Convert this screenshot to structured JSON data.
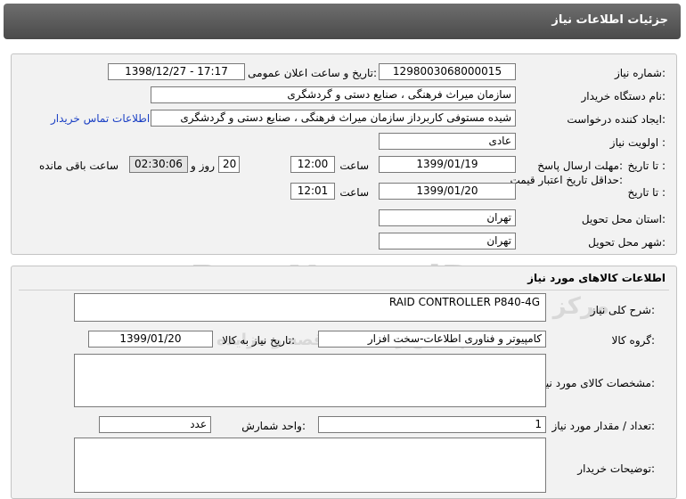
{
  "header": {
    "title": "جزئیات اطلاعات نیاز"
  },
  "need": {
    "need_number_label": "شماره نیاز:",
    "need_number": "1298003068000015",
    "announce_label": "تاریخ و ساعت اعلان عمومی:",
    "announce_value": "1398/12/27 - 17:17",
    "buyer_org_label": "نام دستگاه خریدار:",
    "buyer_org": "سازمان میراث فرهنگی ، صنایع دستی و گردشگری",
    "creator_label": "ایجاد کننده درخواست:",
    "creator": "شیده مستوفی کاربرداز سازمان میراث فرهنگی ، صنایع دستی و گردشگری",
    "contact_link": "اطلاعات تماس خریدار",
    "priority_label": "اولویت نیاز :",
    "priority": "عادی",
    "deadline_label": "مهلت ارسال پاسخ:",
    "to_date_label": "تا تاریخ :",
    "deadline_date": "1399/01/19",
    "time_label": "ساعت",
    "deadline_time": "12:00",
    "days_value": "20",
    "days_label": "روز و",
    "countdown": "02:30:06",
    "remaining_label": "ساعت باقی مانده",
    "validity_label": "حداقل تاریخ اعتبار قیمت:",
    "validity_to_label": "تا تاریخ :",
    "validity_date": "1399/01/20",
    "validity_time_label": "ساعت",
    "validity_time": "12:01",
    "province_label": "استان محل تحویل:",
    "province": "تهران",
    "city_label": "شهر محل تحویل:",
    "city": "تهران"
  },
  "goods": {
    "section_title": "اطلاعات کالاهای مورد نیاز",
    "summary_label": "شرح کلی نیاز:",
    "summary": "RAID CONTROLLER P840-4G",
    "group_label": "گروه کالا:",
    "group": "کامپیوتر و فناوری اطلاعات-سخت افزار",
    "need_date_label": "تاریخ نیاز به کالا:",
    "need_date": "1399/01/20",
    "specs_label": "مشخصات کالای مورد نیاز:",
    "specs": "",
    "qty_label": "تعداد / مقدار مورد نیاز:",
    "qty": "1",
    "unit_label": "واحد شمارش:",
    "unit": "عدد",
    "buyer_notes_label": "توضیحات خریدار:",
    "buyer_notes": ""
  },
  "watermark": {
    "brand": "ParsNamadData",
    "brand_fa": "مرکز فراوری اطلاعات پارس نماد داده ها",
    "subtitle": "پیشگام اطلاع رسانی مناقصه و مزایده",
    "phone": "۰۲۱-۸۸۳۴۹۶۷۰-۵"
  },
  "colors": {
    "titlebar": "#555555",
    "link": "#1a3fc4",
    "panel": "#f2f2f2"
  }
}
